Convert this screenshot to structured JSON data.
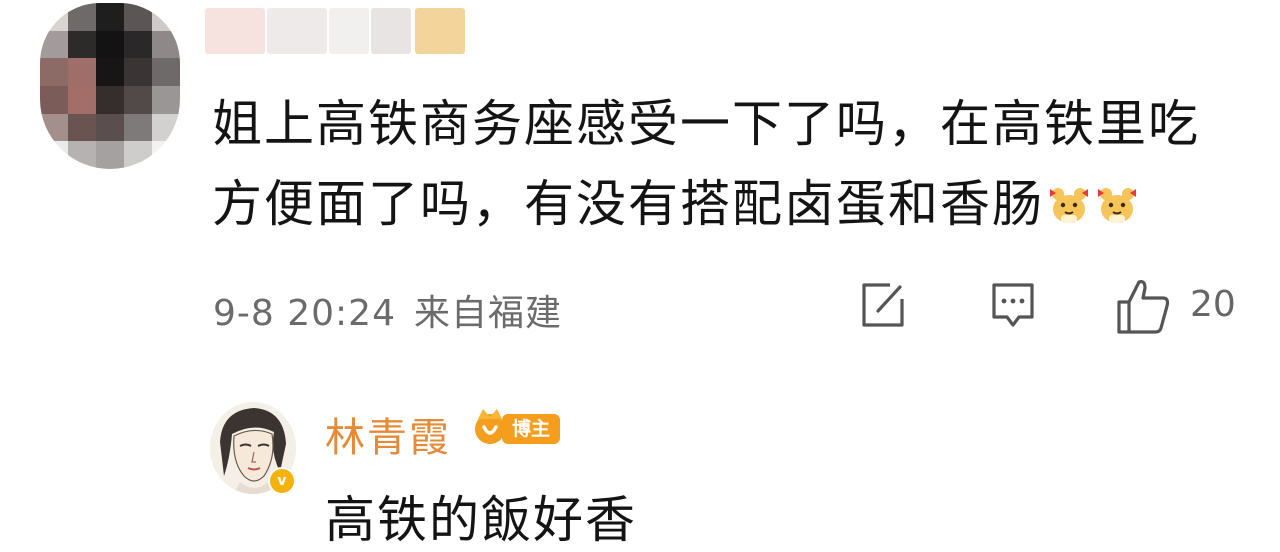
{
  "comment": {
    "author_name": "",
    "text_line1": "姐上高铁商务座感受一下了吗，在高铁里吃",
    "text_line2": "方便面了吗，有没有搭配卤蛋和香肠",
    "emoji": "hamster-emoji",
    "time": "9-8 20:24",
    "location": "来自福建",
    "like_count": "20"
  },
  "actions": {
    "share_icon": "share-edit-icon",
    "comment_icon": "comment-icon",
    "like_icon": "thumbs-up-icon"
  },
  "reply": {
    "author_name": "林青霞",
    "badge_label": "博主",
    "text": "高铁的飯好香"
  },
  "colors": {
    "name_orange": "#e58a36",
    "badge_orange": "#f59d1c",
    "meta_gray": "#6b6b6b"
  }
}
